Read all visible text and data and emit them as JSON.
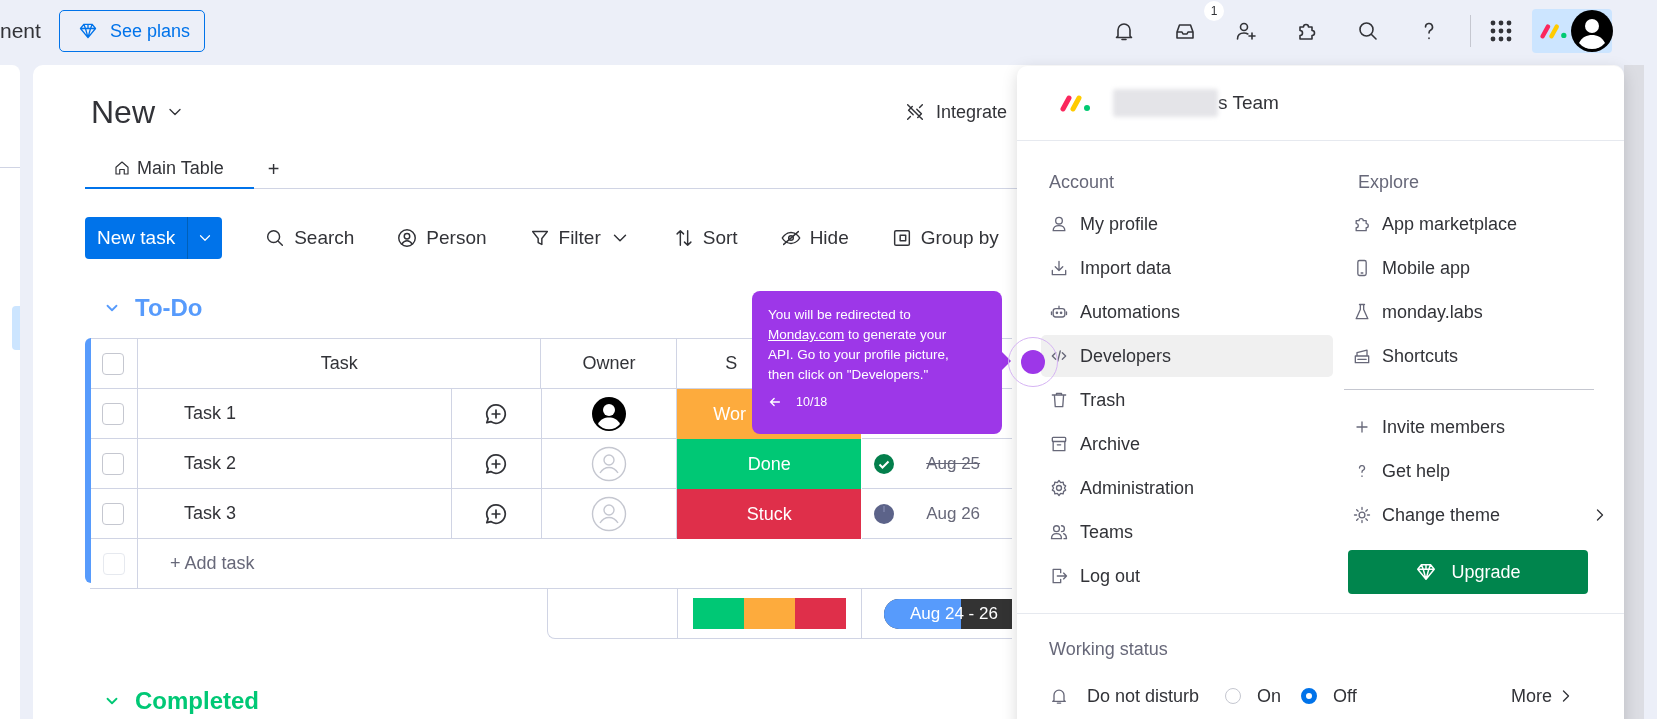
{
  "top_bar": {
    "cut_title": "nent",
    "plans_button": "See plans",
    "inbox_badge": "1"
  },
  "board": {
    "title": "New",
    "integrate": "Integrate",
    "tabs": [
      {
        "label": "Main Table",
        "selected": true
      }
    ],
    "add_tab": "+",
    "new_task": "New task",
    "tools": [
      {
        "kind": "search",
        "label": "Search"
      },
      {
        "kind": "person",
        "label": "Person"
      },
      {
        "kind": "filter",
        "label": "Filter",
        "caret": true
      },
      {
        "kind": "sort",
        "label": "Sort"
      },
      {
        "kind": "hide",
        "label": "Hide"
      },
      {
        "kind": "group",
        "label": "Group by"
      }
    ],
    "groups": [
      {
        "title": "To-Do",
        "color": "#579bfc",
        "expanded": true,
        "table": {
          "all_checked": false,
          "columns": [
            "Task",
            "Owner",
            "S"
          ],
          "rows": [
            {
              "task": "Task 1",
              "checked": false,
              "owner_assigned": true,
              "status": "Wor",
              "color": "#fdab3d"
            },
            {
              "task": "Task 2",
              "checked": false,
              "owner_assigned": false,
              "status": "Done",
              "color": "#00c875",
              "date": "Aug 25",
              "date_done": true
            },
            {
              "task": "Task 3",
              "checked": false,
              "owner_assigned": false,
              "status": "Stuck",
              "color": "#df2f4a",
              "date": "Aug 26",
              "date_done": false
            }
          ],
          "add_row": "+ Add task",
          "add_row_checkbox_disabled": true,
          "summary": {
            "status_segments": [
              {
                "color": "#00c875"
              },
              {
                "color": "#fdab3d"
              },
              {
                "color": "#df2f4a"
              }
            ],
            "timeline": "Aug 24 - 26",
            "level": 0.6
          }
        }
      },
      {
        "title": "Completed",
        "color": "#00c875",
        "expanded": true
      }
    ]
  },
  "tooltip": {
    "before": "You will be redirected to",
    "link": "Monday.com",
    "after": "to generate your API. Go to your profile picture, then click on \"Developers.\"",
    "step": "10/18"
  },
  "menu": {
    "team": "s Team",
    "account_heading": "Account",
    "account_items": [
      {
        "kind": "profile",
        "label": "My profile",
        "selected": false
      },
      {
        "kind": "import",
        "label": "Import data",
        "selected": false
      },
      {
        "kind": "robot",
        "label": "Automations",
        "selected": false
      },
      {
        "kind": "code",
        "label": "Developers",
        "selected": true
      },
      {
        "kind": "trash",
        "label": "Trash",
        "selected": false
      },
      {
        "kind": "archive",
        "label": "Archive",
        "selected": false
      },
      {
        "kind": "gear",
        "label": "Administration",
        "selected": false
      },
      {
        "kind": "teams",
        "label": "Teams",
        "selected": false
      },
      {
        "kind": "logout",
        "label": "Log out",
        "selected": false
      }
    ],
    "explore_heading": "Explore",
    "explore_items": [
      {
        "kind": "puzzle",
        "label": "App marketplace"
      },
      {
        "kind": "phone",
        "label": "Mobile app"
      },
      {
        "kind": "flask",
        "label": "monday.labs"
      },
      {
        "kind": "keyboard",
        "label": "Shortcuts"
      }
    ],
    "more_items": [
      {
        "kind": "plus",
        "label": "Invite members"
      },
      {
        "kind": "help",
        "label": "Get help"
      },
      {
        "kind": "sun",
        "label": "Change theme",
        "submenu": true
      }
    ],
    "upgrade": "Upgrade",
    "working_heading": "Working status",
    "dnd_label": "Do not disturb",
    "dnd_options": [
      {
        "label": "On",
        "selected": false
      },
      {
        "label": "Off",
        "selected": true
      }
    ],
    "more": "More"
  }
}
